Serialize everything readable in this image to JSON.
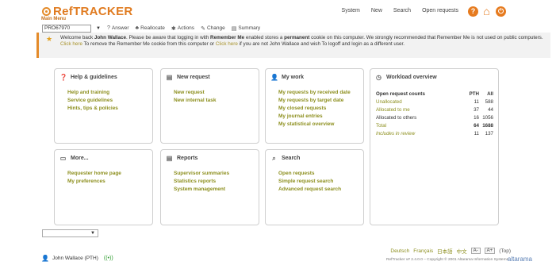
{
  "app": {
    "logo_text": "RefTRACKER",
    "main_menu": "Main Menu"
  },
  "topnav": [
    "System",
    "New",
    "Search",
    "Open requests"
  ],
  "header_icons": [
    {
      "name": "help-icon",
      "glyph": "?"
    },
    {
      "name": "home-icon",
      "glyph": "⌂"
    },
    {
      "name": "power-icon",
      "glyph": "⏻"
    }
  ],
  "toolbar": {
    "request_id": "PRO67970",
    "buttons": [
      {
        "icon": "?",
        "label": "Answer"
      },
      {
        "icon": "♣",
        "label": "Reallocate"
      },
      {
        "icon": "✱",
        "label": "Actions"
      },
      {
        "icon": "✎",
        "label": "Change"
      },
      {
        "icon": "▤",
        "label": "Summary"
      }
    ]
  },
  "notice": {
    "p1": "Welcome back ",
    "user": "John Wallace",
    "p2": ". Please be aware that logging in with ",
    "remember": "Remember Me",
    "p3": " enabled stores a ",
    "permanent": "permanent",
    "p4": " cookie on this computer. We strongly recommended that Remember Me is not used on public computers.",
    "link1": "Click here",
    "p5": " To remove the Remember Me cookie from this computer or ",
    "link2": "Click here",
    "p6": " if you are not John Wallace and wish To logoff and login as a different user."
  },
  "panels": {
    "help": {
      "title": "Help & guidelines",
      "links": [
        "Help and training",
        "Service guidelines",
        "Hints, tips & policies"
      ]
    },
    "new_request": {
      "title": "New request",
      "links": [
        "New request",
        "New internal task"
      ]
    },
    "my_work": {
      "title": "My work",
      "links": [
        "My requests by received date",
        "My requests by target date",
        "My closed requests",
        "My journal entries",
        "My statistical overview"
      ]
    },
    "more": {
      "title": "More...",
      "links": [
        "Requester home page",
        "My preferences"
      ]
    },
    "reports": {
      "title": "Reports",
      "links": [
        "Supervisor summaries",
        "Statistics reports",
        "System management"
      ]
    },
    "search": {
      "title": "Search",
      "links": [
        "Open requests",
        "Simple request search",
        "Advanced request search"
      ]
    },
    "workload": {
      "title": "Workload overview",
      "header": [
        "Open request counts",
        "PTH",
        "All"
      ],
      "rows": [
        {
          "label": "Unallocated",
          "pth": "11",
          "all": "588"
        },
        {
          "label": "Allocated to me",
          "pth": "37",
          "all": "44"
        },
        {
          "label": "Allocated to others",
          "pth": "16",
          "all": "1056"
        },
        {
          "label": "Total",
          "pth": "64",
          "all": "1688"
        },
        {
          "label": "Includes in review",
          "pth": "11",
          "all": "137"
        }
      ]
    }
  },
  "footer": {
    "languages": [
      "Deutsch",
      "Français",
      "日本語",
      "中文"
    ],
    "font_smaller": "A-",
    "font_larger": "A+",
    "top": "(Top)",
    "user": "John Wallace (PTH)",
    "copyright": "RefTracker v# 2.4.0.0 – Copyright © 2001 Altarama Information Systems",
    "brand": "altarama"
  }
}
